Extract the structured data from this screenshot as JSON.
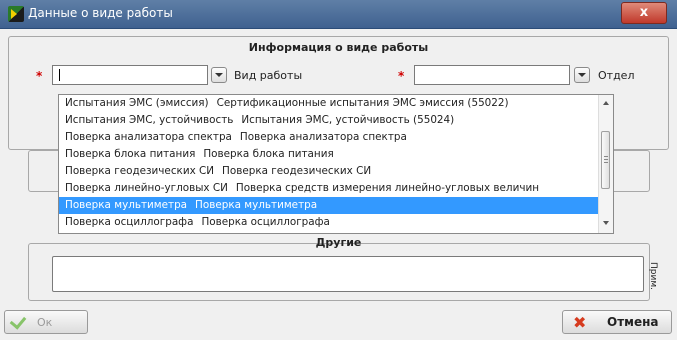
{
  "window": {
    "title": "Данные о виде работы",
    "close_label": "x"
  },
  "header": {
    "section_title": "Информация о виде работы"
  },
  "fields": {
    "required_mark": "*",
    "work_type_label": "Вид работы",
    "department_label": "Отдел"
  },
  "dropdown": {
    "items": [
      {
        "code": "Испытания ЭМС (эмиссия)",
        "name": "Сертификационные испытания ЭМС эмиссия (55022)"
      },
      {
        "code": "Испытания ЭМС, устойчивость",
        "name": "Испытания ЭМС, устойчивость (55024)"
      },
      {
        "code": "Поверка анализатора спектра",
        "name": "Поверка анализатора спектра"
      },
      {
        "code": "Поверка блока питания",
        "name": "Поверка блока питания"
      },
      {
        "code": "Поверка геодезических СИ",
        "name": "Поверка геодезических СИ"
      },
      {
        "code": "Поверка линейно-угловых СИ",
        "name": "Поверка средств измерения линейно-угловых величин"
      },
      {
        "code": "Поверка мультиметра",
        "name": "Поверка мультиметра"
      },
      {
        "code": "Поверка осциллографа",
        "name": "Поверка осциллографа"
      }
    ],
    "selected_index": 6
  },
  "others": {
    "title": "Другие",
    "note_label": "Прим."
  },
  "buttons": {
    "ok": "Ок",
    "cancel": "Отмена"
  }
}
